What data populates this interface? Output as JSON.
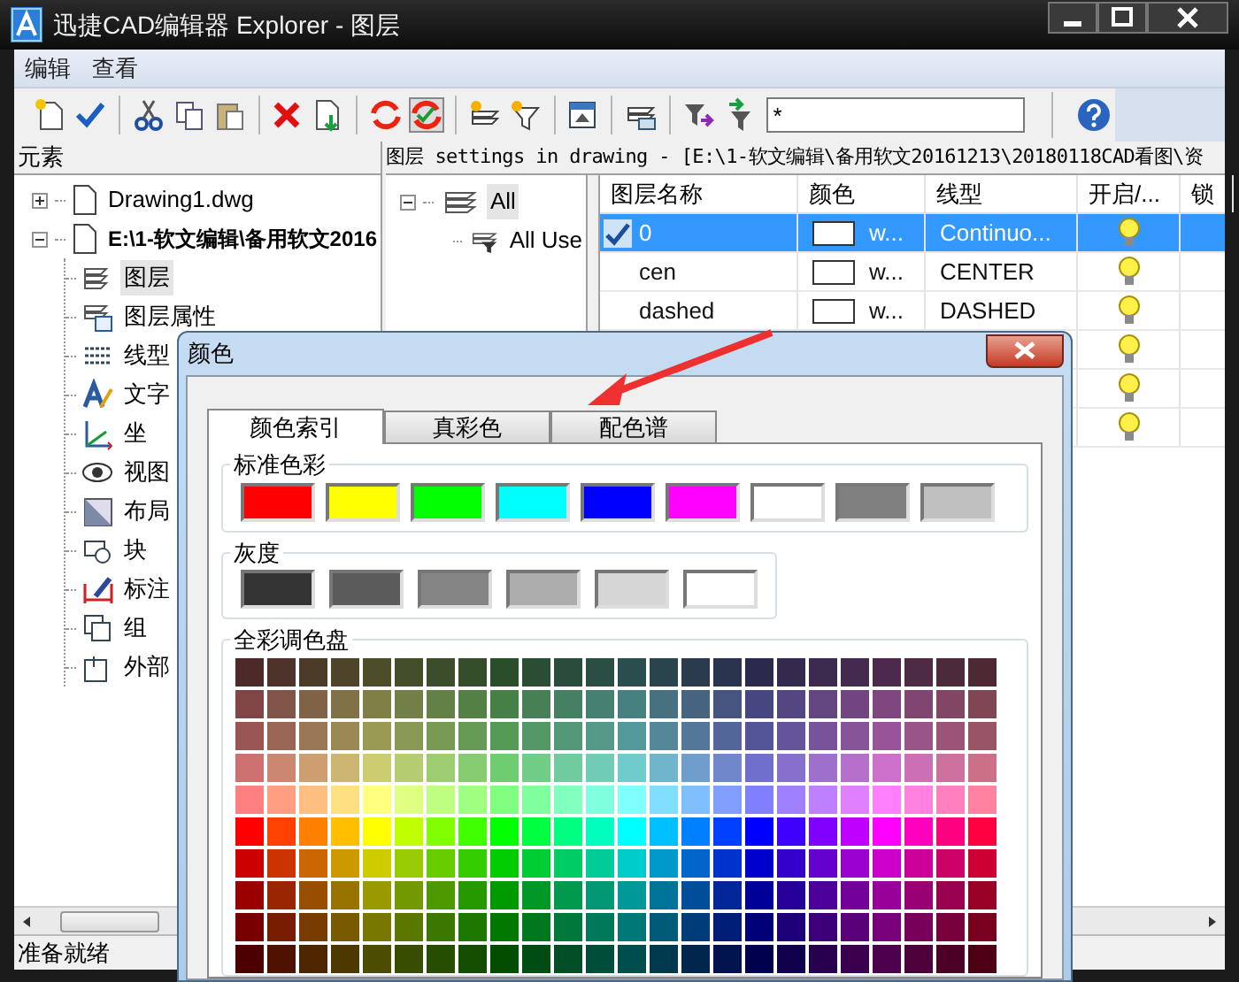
{
  "window": {
    "title": "迅捷CAD编辑器 Explorer - 图层"
  },
  "menu": [
    "编辑",
    "查看"
  ],
  "toolbar": {
    "filter": {
      "value": "*"
    }
  },
  "elements_panel": {
    "title": "元素",
    "tree": [
      {
        "label": "Drawing1.dwg",
        "expanded": false,
        "selected": false
      },
      {
        "label": "E:\\1-软文编辑\\备用软文2016",
        "expanded": true,
        "selected": false,
        "children": [
          {
            "label": "图层",
            "selected": true
          },
          {
            "label": "图层属性",
            "selected": false
          },
          {
            "label": "线型",
            "selected": false
          },
          {
            "label": "文字",
            "selected": false
          },
          {
            "label": "坐",
            "selected": false
          },
          {
            "label": "视图",
            "selected": false
          },
          {
            "label": "布局",
            "selected": false
          },
          {
            "label": "块",
            "selected": false
          },
          {
            "label": "标注",
            "selected": false
          },
          {
            "label": "组",
            "selected": false
          },
          {
            "label": "外部",
            "selected": false
          }
        ]
      }
    ]
  },
  "layer_panel": {
    "header": "图层 settings in drawing - [E:\\1-软文编辑\\备用软文20161213\\20180118CAD看图\\资",
    "filters": [
      {
        "label": "All",
        "expanded": true,
        "selected": true,
        "children": [
          {
            "label": "All Use",
            "selected": false
          }
        ]
      }
    ],
    "table": {
      "columns": [
        "图层名称",
        "颜色",
        "线型",
        "开启/...",
        "锁"
      ],
      "rows": [
        {
          "name": "0",
          "current": true,
          "selected": true,
          "color_name": "w...",
          "linetype": "Continuo...",
          "on": true
        },
        {
          "name": "cen",
          "current": false,
          "selected": false,
          "color_name": "w...",
          "linetype": "CENTER",
          "on": true
        },
        {
          "name": "dashed",
          "current": false,
          "selected": false,
          "color_name": "w...",
          "linetype": "DASHED",
          "on": true
        },
        {
          "selected": false,
          "on": true
        },
        {
          "selected": false,
          "on": true
        },
        {
          "selected": false,
          "on": true
        }
      ]
    }
  },
  "status_bar": "准备就绪",
  "dialog": {
    "title": "颜色",
    "tabs": [
      {
        "label": "颜色索引",
        "selected": true
      },
      {
        "label": "真彩色",
        "selected": false
      },
      {
        "label": "配色谱",
        "selected": false
      }
    ],
    "standard_colors": {
      "label": "标准色彩",
      "swatches": [
        {
          "color": "#ff0000"
        },
        {
          "color": "#ffff00"
        },
        {
          "color": "#00ff00"
        },
        {
          "color": "#00ffff"
        },
        {
          "color": "#0000ff"
        },
        {
          "color": "#ff00ff"
        },
        {
          "color": "#ffffff"
        },
        {
          "color": "#808080"
        },
        {
          "color": "#c0c0c0"
        }
      ]
    },
    "grayscale": {
      "label": "灰度",
      "swatches": [
        {
          "color": "#333333"
        },
        {
          "color": "#5b5b5b"
        },
        {
          "color": "#848484"
        },
        {
          "color": "#adadad"
        },
        {
          "color": "#d6d6d6"
        },
        {
          "color": "#ffffff"
        }
      ]
    },
    "palette": {
      "label": "全彩调色盘"
    }
  }
}
